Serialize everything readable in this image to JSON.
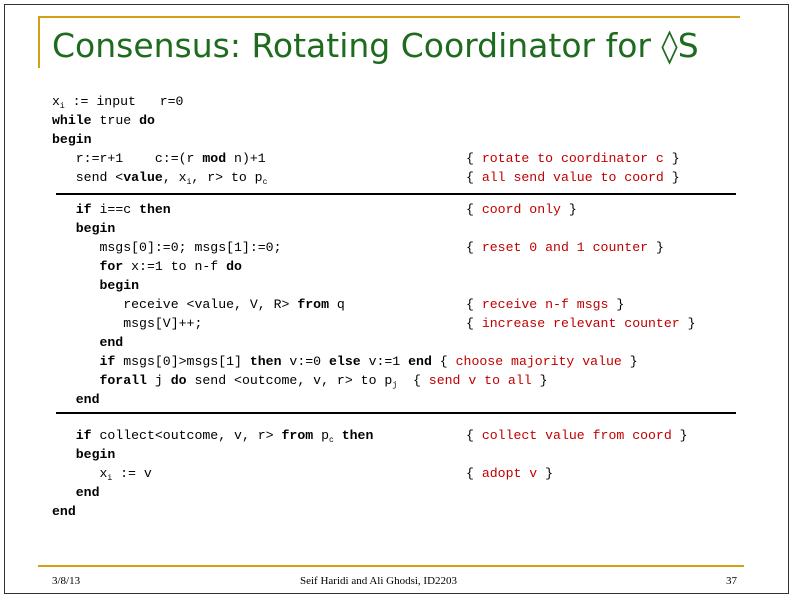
{
  "slide": {
    "title": "Consensus: Rotating Coordinator for ◊S",
    "code": [
      {
        "segs": [
          {
            "t": "x"
          },
          {
            "t": "i",
            "sub": 1
          },
          {
            "t": " := input   r=0"
          }
        ]
      },
      {
        "segs": [
          {
            "t": "while",
            "b": 1
          },
          {
            "t": " true "
          },
          {
            "t": "do",
            "b": 1
          }
        ]
      },
      {
        "segs": [
          {
            "t": "begin",
            "b": 1
          }
        ]
      },
      {
        "segs": [
          {
            "t": "   r:=r+1    c:=(r "
          },
          {
            "t": "mod",
            "b": 1
          },
          {
            "t": " n)+1"
          }
        ],
        "comment": "rotate to coordinator c"
      },
      {
        "segs": [
          {
            "t": "   send <"
          },
          {
            "t": "value",
            "b": 1
          },
          {
            "t": ", x"
          },
          {
            "t": "i",
            "sub": 1
          },
          {
            "t": ", r> to p"
          },
          {
            "t": "c",
            "sub": 1
          }
        ],
        "comment": "all send value to coord"
      },
      {
        "segs": [
          {
            "t": "   "
          },
          {
            "t": "if",
            "b": 1
          },
          {
            "t": " i==c "
          },
          {
            "t": "then",
            "b": 1
          }
        ],
        "comment": "coord only"
      },
      {
        "segs": [
          {
            "t": "   "
          },
          {
            "t": "begin",
            "b": 1
          }
        ]
      },
      {
        "segs": [
          {
            "t": "      msgs[0]:=0; msgs[1]:=0;"
          }
        ],
        "comment": "reset 0 and 1 counter"
      },
      {
        "segs": [
          {
            "t": "      "
          },
          {
            "t": "for",
            "b": 1
          },
          {
            "t": " x:=1 to n-f "
          },
          {
            "t": "do",
            "b": 1
          }
        ]
      },
      {
        "segs": [
          {
            "t": "      "
          },
          {
            "t": "begin",
            "b": 1
          }
        ]
      },
      {
        "segs": [
          {
            "t": "         receive <value, V, R> "
          },
          {
            "t": "from",
            "b": 1
          },
          {
            "t": " q"
          }
        ],
        "comment": "receive n-f msgs"
      },
      {
        "segs": [
          {
            "t": "         msgs[V]++;"
          }
        ],
        "comment": "increase relevant counter"
      },
      {
        "segs": [
          {
            "t": "      "
          },
          {
            "t": "end",
            "b": 1
          }
        ]
      },
      {
        "segs": [
          {
            "t": "      "
          },
          {
            "t": "if",
            "b": 1
          },
          {
            "t": " msgs[0]>msgs[1] "
          },
          {
            "t": "then",
            "b": 1
          },
          {
            "t": " v:=0 "
          },
          {
            "t": "else",
            "b": 1
          },
          {
            "t": " v:=1 "
          },
          {
            "t": "end",
            "b": 1
          },
          {
            "t": " { "
          },
          {
            "t": "choose majority value",
            "red": 1
          },
          {
            "t": " }"
          }
        ]
      },
      {
        "segs": [
          {
            "t": "      "
          },
          {
            "t": "forall",
            "b": 1
          },
          {
            "t": " j "
          },
          {
            "t": "do",
            "b": 1
          },
          {
            "t": " send <outcome, v, r> to p"
          },
          {
            "t": "j",
            "sub": 1
          },
          {
            "t": "  { "
          },
          {
            "t": "send v to all",
            "red": 1
          },
          {
            "t": " }"
          }
        ]
      },
      {
        "segs": [
          {
            "t": "   "
          },
          {
            "t": "end",
            "b": 1
          }
        ]
      },
      {
        "segs": [
          {
            "t": "   "
          },
          {
            "t": "if",
            "b": 1
          },
          {
            "t": " collect<outcome, v, r> "
          },
          {
            "t": "from",
            "b": 1
          },
          {
            "t": " p"
          },
          {
            "t": "c",
            "sub": 1
          },
          {
            "t": " "
          },
          {
            "t": "then",
            "b": 1
          }
        ],
        "comment": "collect value from coord"
      },
      {
        "segs": [
          {
            "t": "   "
          },
          {
            "t": "begin",
            "b": 1
          }
        ]
      },
      {
        "segs": [
          {
            "t": "      x"
          },
          {
            "t": "i",
            "sub": 1
          },
          {
            "t": " := v"
          }
        ],
        "comment": "adopt v"
      },
      {
        "segs": [
          {
            "t": "   "
          },
          {
            "t": "end",
            "b": 1
          }
        ]
      },
      {
        "segs": [
          {
            "t": "end",
            "b": 1
          }
        ]
      }
    ]
  },
  "footer": {
    "date": "3/8/13",
    "author": "Seif Haridi and Ali Ghodsi, ID2203",
    "page": "37"
  },
  "colors": {
    "title": "#1e6a1e",
    "accent": "#d4a017",
    "comment": "#c00000"
  }
}
